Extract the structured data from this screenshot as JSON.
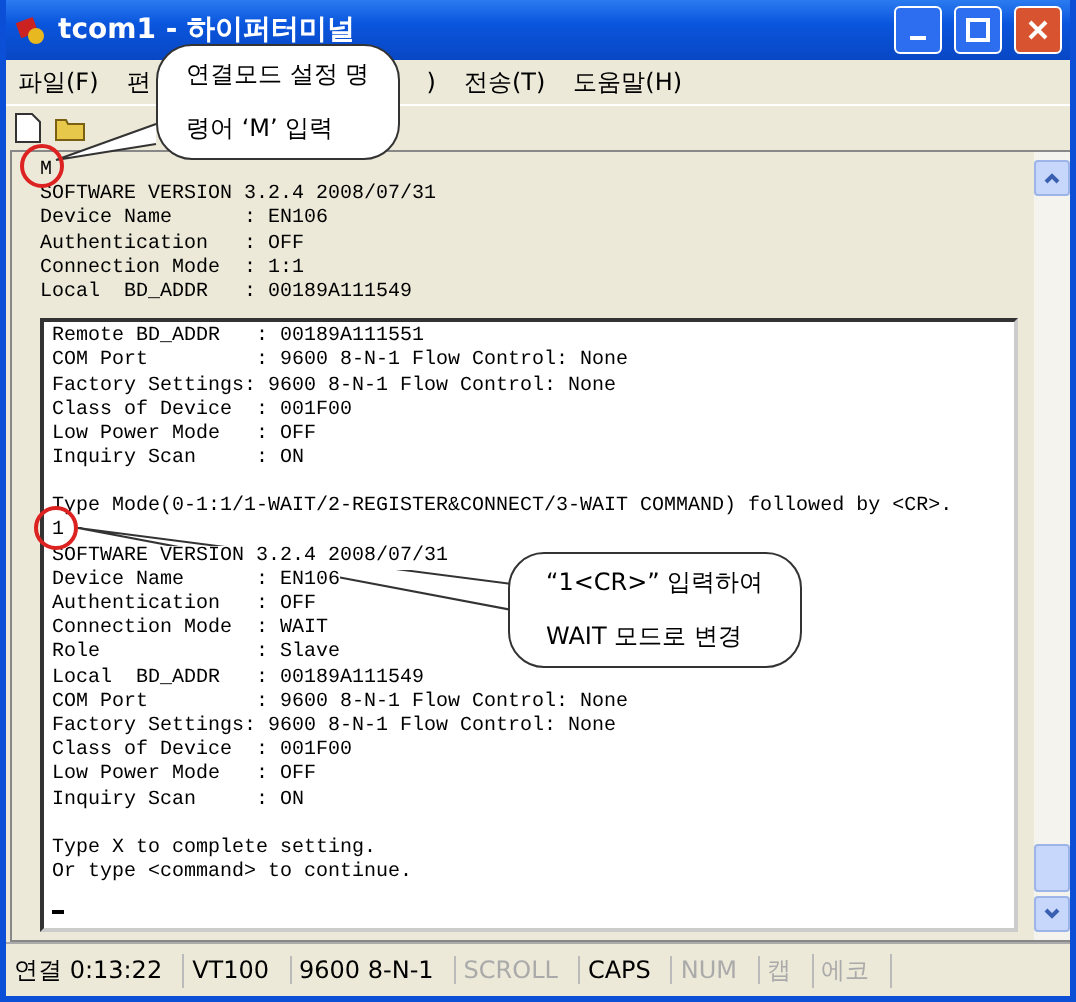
{
  "window": {
    "title": "tcom1 - 하이퍼터미널"
  },
  "menu": [
    {
      "label": "파일(F)"
    },
    {
      "label": "편"
    },
    {
      "label": ")"
    },
    {
      "label": "전송(T)"
    },
    {
      "label": "도움말(H)"
    }
  ],
  "terminal": {
    "top_lines": [
      "M",
      "SOFTWARE VERSION 3.2.4 2008/07/31",
      "Device Name      : EN106",
      "Authentication   : OFF",
      "Connection Mode  : 1:1",
      "Local  BD_ADDR   : 00189A111549"
    ],
    "panel_blocks": [
      [
        "Remote BD_ADDR   : 00189A111551",
        "COM Port         : 9600 8-N-1 Flow Control: None",
        "Factory Settings: 9600 8-N-1 Flow Control: None",
        "Class of Device  : 001F00",
        "Low Power Mode   : OFF",
        "Inquiry Scan     : ON"
      ],
      [
        "Type Mode(0-1:1/1-WAIT/2-REGISTER&CONNECT/3-WAIT COMMAND) followed by <CR>.",
        "1",
        "SOFTWARE VERSION 3.2.4 2008/07/31",
        "Device Name      : EN106",
        "Authentication   : OFF",
        "Connection Mode  : WAIT",
        "Role             : Slave",
        "Local  BD_ADDR   : 00189A111549",
        "COM Port         : 9600 8-N-1 Flow Control: None",
        "Factory Settings: 9600 8-N-1 Flow Control: None",
        "Class of Device  : 001F00",
        "Low Power Mode   : OFF",
        "Inquiry Scan     : ON"
      ],
      [
        "Type X to complete setting.",
        "Or type <command> to continue."
      ]
    ]
  },
  "callouts": [
    {
      "lines": [
        "연결모드 설정 명",
        "령어 ‘M’ 입력"
      ]
    },
    {
      "lines": [
        "“1<CR>” 입력하여",
        "WAIT 모드로 변경"
      ]
    }
  ],
  "status_bar": [
    {
      "label": "연결 0:13:22",
      "disabled": false
    },
    {
      "label": "VT100",
      "disabled": false
    },
    {
      "label": "9600 8-N-1",
      "disabled": false
    },
    {
      "label": "SCROLL",
      "disabled": true
    },
    {
      "label": "CAPS",
      "disabled": false
    },
    {
      "label": "NUM",
      "disabled": true
    },
    {
      "label": "캡",
      "disabled": true
    },
    {
      "label": "에코",
      "disabled": true
    }
  ]
}
